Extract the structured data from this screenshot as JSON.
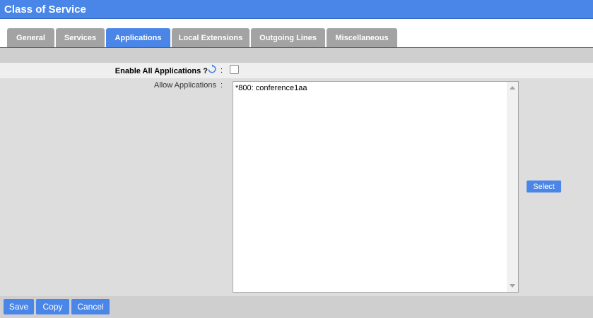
{
  "window": {
    "title": "Class of Service"
  },
  "tabs": [
    {
      "label": "General",
      "active": false
    },
    {
      "label": "Services",
      "active": false
    },
    {
      "label": "Applications",
      "active": true
    },
    {
      "label": "Local Extensions",
      "active": false
    },
    {
      "label": "Outgoing Lines",
      "active": false
    },
    {
      "label": "Miscellaneous",
      "active": false
    }
  ],
  "form": {
    "enable_all": {
      "label": "Enable All Applications ?",
      "separator": ":",
      "checked": false,
      "icon": "refresh-icon"
    },
    "allow_applications": {
      "label": "Allow Applications",
      "separator": ":",
      "items": [
        "*800: conference1aa"
      ]
    },
    "select_label": "Select"
  },
  "footer": {
    "save_label": "Save",
    "copy_label": "Copy",
    "cancel_label": "Cancel"
  },
  "colors": {
    "accent": "#4a86e8",
    "tab_inactive": "#a3a3a3",
    "panel": "#dddddd"
  }
}
